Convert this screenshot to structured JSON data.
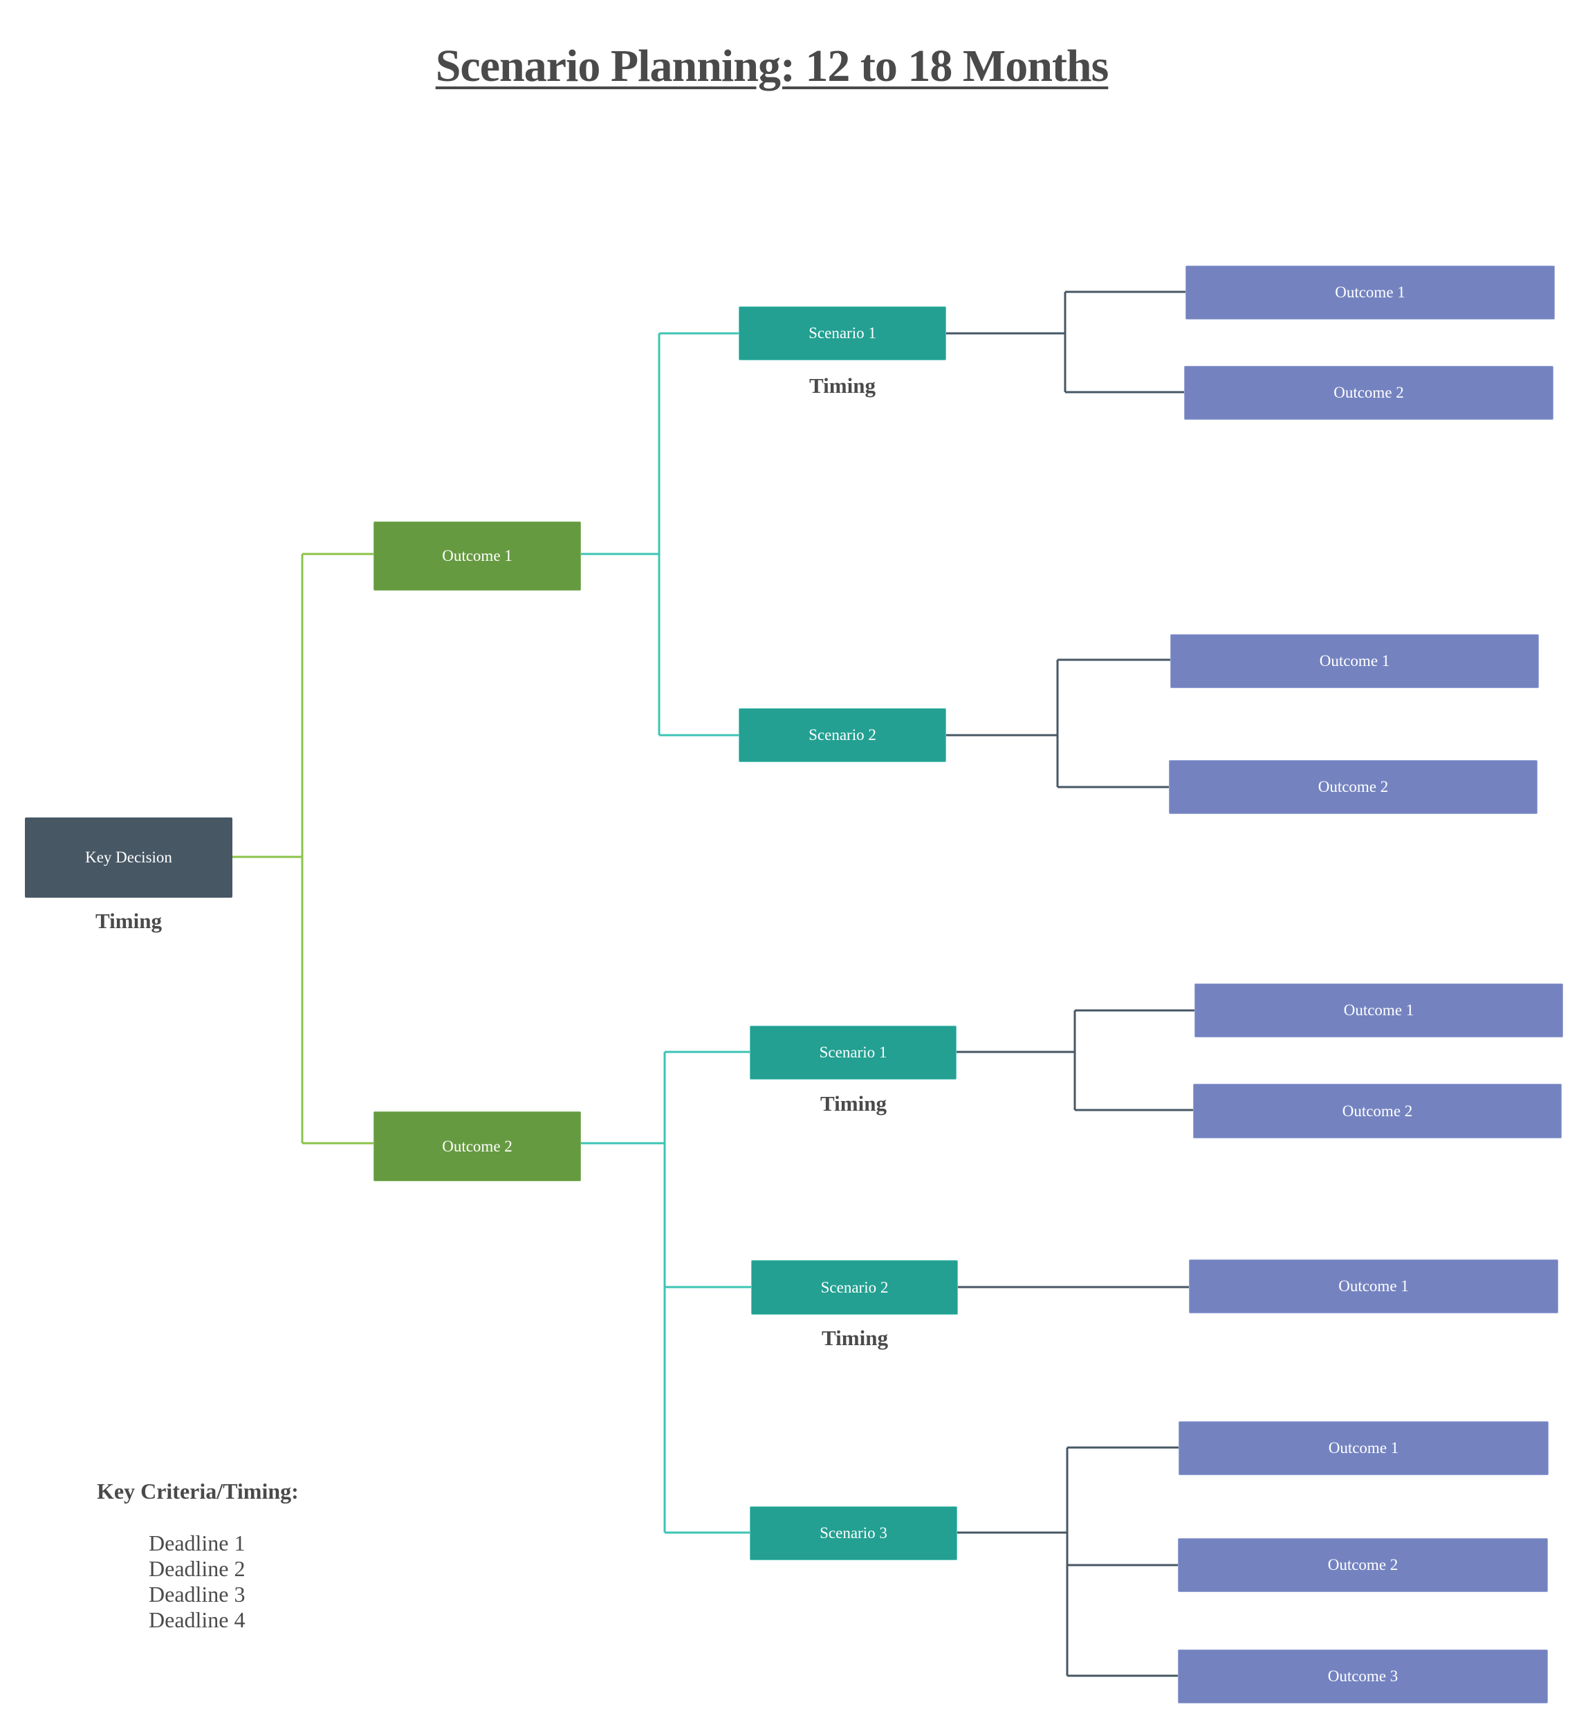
{
  "title": "Scenario Planning: 12 to 18 Months",
  "colors": {
    "root": "#475764",
    "outcome_level1": "#669a40",
    "scenario": "#23a092",
    "outcome_level3": "#7483c0",
    "connector_root": "#8bc34a",
    "connector_scenario": "#3cc4b4",
    "connector_outcome": "#475764",
    "text": "#4a4a4a"
  },
  "root": {
    "label": "Key Decision",
    "timing": "Timing",
    "children": [
      {
        "label": "Outcome 1",
        "scenarios": [
          {
            "label": "Scenario 1",
            "timing": "Timing",
            "outcomes": [
              "Outcome 1",
              "Outcome 2"
            ]
          },
          {
            "label": "Scenario 2",
            "timing": null,
            "outcomes": [
              "Outcome 1",
              "Outcome 2"
            ]
          }
        ]
      },
      {
        "label": "Outcome 2",
        "scenarios": [
          {
            "label": "Scenario 1",
            "timing": "Timing",
            "outcomes": [
              "Outcome 1",
              "Outcome 2"
            ]
          },
          {
            "label": "Scenario 2",
            "timing": "Timing",
            "outcomes": [
              "Outcome 1"
            ]
          },
          {
            "label": "Scenario 3",
            "timing": null,
            "outcomes": [
              "Outcome 1",
              "Outcome 2",
              "Outcome 3"
            ]
          }
        ]
      }
    ]
  },
  "criteria": {
    "heading": "Key Criteria/Timing:",
    "deadlines": [
      "Deadline 1",
      "Deadline 2",
      "Deadline 3",
      "Deadline 4"
    ]
  }
}
